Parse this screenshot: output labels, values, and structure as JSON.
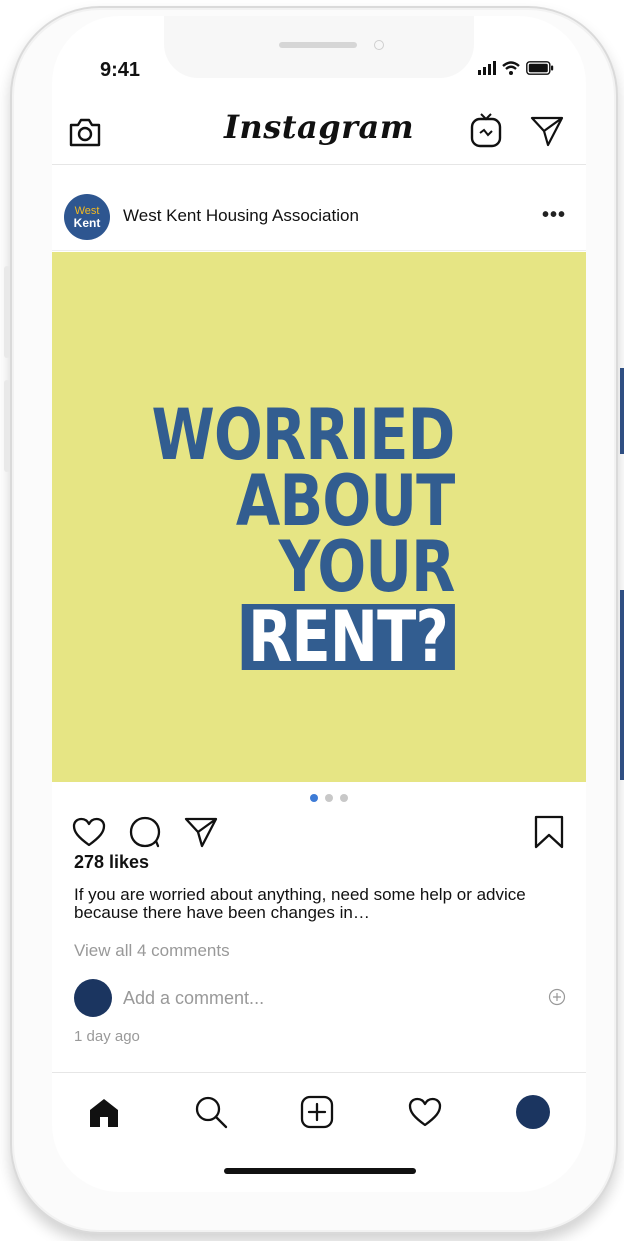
{
  "status_bar": {
    "time": "9:41"
  },
  "app": {
    "logo_text": "Instagram"
  },
  "post": {
    "account_logo_line1": "West",
    "account_logo_line2": "Kent",
    "username": "West Kent Housing Association",
    "more_label": "•••",
    "image_text": {
      "line1": "WORRIED",
      "line2": "ABOUT",
      "line3": "YOUR",
      "line4": "RENT?"
    },
    "carousel": {
      "count": 3,
      "active_index": 0
    },
    "likes": "278 likes",
    "caption": "If you are worried about anything, need some help or advice because there have been changes in…",
    "view_comments": "View all 4 comments",
    "comment_placeholder": "Add a comment...",
    "time_ago": "1 day ago"
  },
  "colors": {
    "image_background": "#e6e584",
    "brand_blue": "#325d90",
    "logo_yellow": "#f3b91f",
    "avatar_navy": "#1b3560",
    "carousel_active": "#3d7bd6"
  },
  "icons": {
    "top_left": "camera-icon",
    "top_right": [
      "igtv-icon",
      "direct-message-icon"
    ],
    "actions": [
      "heart-icon",
      "comment-icon",
      "share-icon",
      "bookmark-icon"
    ],
    "tabs": [
      "home-icon",
      "search-icon",
      "add-post-icon",
      "activity-heart-icon",
      "profile-avatar"
    ]
  }
}
